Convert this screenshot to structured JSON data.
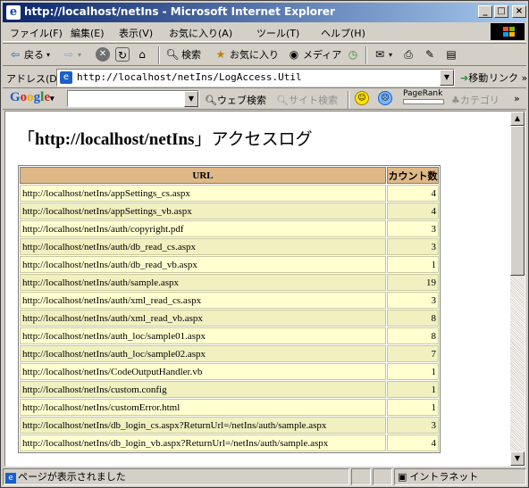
{
  "window": {
    "title": "http://localhost/netIns - Microsoft Internet Explorer",
    "min_label": "_",
    "max_label": "□",
    "close_label": "×"
  },
  "menu": [
    "ファイル(F)",
    "編集(E)",
    "表示(V)",
    "お気に入り(A)",
    "ツール(T)",
    "ヘルプ(H)"
  ],
  "toolbar": {
    "back": "戻る",
    "search": "検索",
    "favorites": "お気に入り",
    "media": "メディア"
  },
  "address": {
    "label": "アドレス(D)",
    "value": "http://localhost/netIns/LogAccess.Util",
    "go": "移動",
    "links": "リンク"
  },
  "google": {
    "logo": "Google",
    "search_placeholder": "",
    "web_search": "ウェブ検索",
    "site_search": "サイト検索",
    "pagerank": "PageRank",
    "category": "カテゴリ"
  },
  "page": {
    "heading_open": "「",
    "heading_site": "http://localhost/netIns",
    "heading_close": "」",
    "heading_suffix": "アクセスログ",
    "columns": [
      "URL",
      "カウント数"
    ],
    "rows": [
      {
        "url": "http://localhost/netIns/appSettings_cs.aspx",
        "count": "4"
      },
      {
        "url": "http://localhost/netIns/appSettings_vb.aspx",
        "count": "4"
      },
      {
        "url": "http://localhost/netIns/auth/copyright.pdf",
        "count": "3"
      },
      {
        "url": "http://localhost/netIns/auth/db_read_cs.aspx",
        "count": "3"
      },
      {
        "url": "http://localhost/netIns/auth/db_read_vb.aspx",
        "count": "1"
      },
      {
        "url": "http://localhost/netIns/auth/sample.aspx",
        "count": "19"
      },
      {
        "url": "http://localhost/netIns/auth/xml_read_cs.aspx",
        "count": "3"
      },
      {
        "url": "http://localhost/netIns/auth/xml_read_vb.aspx",
        "count": "8"
      },
      {
        "url": "http://localhost/netIns/auth_loc/sample01.aspx",
        "count": "8"
      },
      {
        "url": "http://localhost/netIns/auth_loc/sample02.aspx",
        "count": "7"
      },
      {
        "url": "http://localhost/netIns/CodeOutputHandler.vb",
        "count": "1"
      },
      {
        "url": "http://localhost/netIns/custom.config",
        "count": "1"
      },
      {
        "url": "http://localhost/netIns/customError.html",
        "count": "1"
      },
      {
        "url": "http://localhost/netIns/db_login_cs.aspx?ReturnUrl=/netIns/auth/sample.aspx",
        "count": "3"
      },
      {
        "url": "http://localhost/netIns/db_login_vb.aspx?ReturnUrl=/netIns/auth/sample.aspx",
        "count": "4"
      }
    ]
  },
  "status": {
    "text": "ページが表示されました",
    "zone": "イントラネット"
  }
}
